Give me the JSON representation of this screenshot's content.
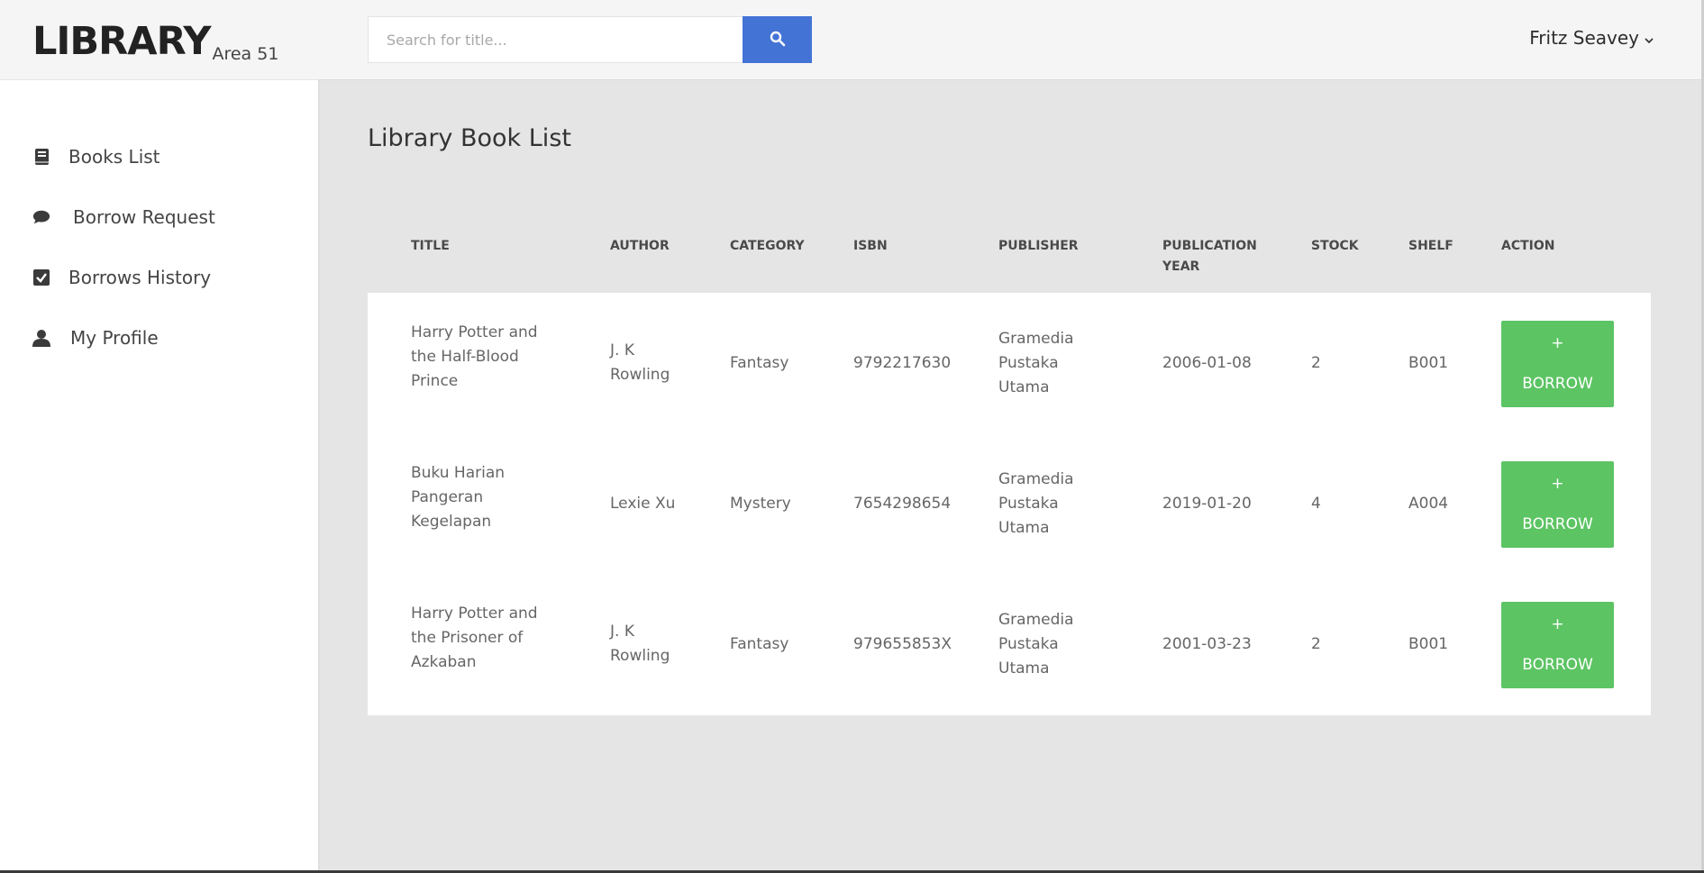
{
  "brand": {
    "name": "LIBRARY",
    "sub": "Area 51"
  },
  "sidebar": {
    "items": [
      {
        "label": "Books List",
        "icon": "book-icon"
      },
      {
        "label": "Borrow Request",
        "icon": "chat-bubble-icon"
      },
      {
        "label": "Borrows History",
        "icon": "checkbox-icon"
      },
      {
        "label": "My Profile",
        "icon": "user-icon"
      }
    ]
  },
  "header": {
    "search_placeholder": "Search for title...",
    "user_name": "Fritz Seavey"
  },
  "page": {
    "title": "Library Book List"
  },
  "table": {
    "columns": [
      "TITLE",
      "AUTHOR",
      "CATEGORY",
      "ISBN",
      "PUBLISHER",
      "PUBLICATION",
      "YEAR",
      "STOCK",
      "SHELF",
      "ACTION"
    ],
    "rows": [
      {
        "title1": "Harry Potter and",
        "title2": "the Half-Blood",
        "title3": "Prince",
        "author1": "J. K",
        "author2": "Rowling",
        "category": "Fantasy",
        "isbn": "9792217630",
        "pub1": "Gramedia",
        "pub2": "Pustaka",
        "pub3": "Utama",
        "year": "2006-01-08",
        "stock": "2",
        "shelf": "B001",
        "plus": "+",
        "action": "BORROW"
      },
      {
        "title1": "Buku Harian",
        "title2": "Pangeran",
        "title3": "Kegelapan",
        "author1": "Lexie Xu",
        "author2": "",
        "category": "Mystery",
        "isbn": "7654298654",
        "pub1": "Gramedia",
        "pub2": "Pustaka",
        "pub3": "Utama",
        "year": "2019-01-20",
        "stock": "4",
        "shelf": "A004",
        "plus": "+",
        "action": "BORROW"
      },
      {
        "title1": "Harry Potter and",
        "title2": "the Prisoner of",
        "title3": "Azkaban",
        "author1": "J. K",
        "author2": "Rowling",
        "category": "Fantasy",
        "isbn": "979655853X",
        "pub1": "Gramedia",
        "pub2": "Pustaka",
        "pub3": "Utama",
        "year": "2001-03-23",
        "stock": "2",
        "shelf": "B001",
        "plus": "+",
        "action": "BORROW"
      }
    ]
  },
  "colors": {
    "accent": "#4473d6",
    "borrow": "#5cc463"
  }
}
